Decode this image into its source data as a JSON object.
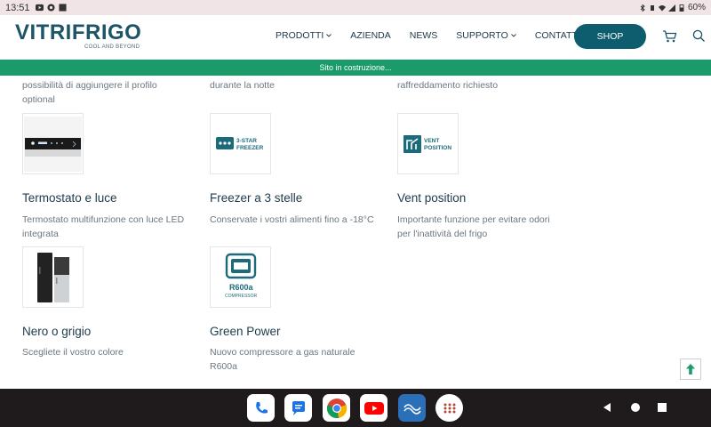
{
  "status": {
    "time": "13:51",
    "battery": "60%"
  },
  "header": {
    "logo": {
      "name": "VITRIFRIGO",
      "tagline": "COOL AND BEYOND"
    },
    "nav": [
      {
        "label": "PRODOTTI",
        "dropdown": true
      },
      {
        "label": "AZIENDA",
        "dropdown": false
      },
      {
        "label": "NEWS",
        "dropdown": false
      },
      {
        "label": "SUPPORTO",
        "dropdown": true
      },
      {
        "label": "CONTATTI",
        "dropdown": true
      }
    ],
    "shop_label": "SHOP",
    "accent": "#0e5d6e"
  },
  "banner": {
    "text": "Sito in costruzione...",
    "color": "#1c9b6a"
  },
  "fragments": {
    "col1_line1": "possibilità di aggiungere il profilo",
    "col1_line2": "optional",
    "col2_line1": "durante la notte",
    "col3_line1": "raffreddamento richiesto"
  },
  "features": [
    {
      "title": "Termostato e luce",
      "desc_lines": [
        "Termostato multifunzione con luce LED",
        "integrata"
      ],
      "icon": "thermostat-light-image"
    },
    {
      "title": "Freezer a 3 stelle",
      "desc_lines": [
        "Conservate i vostri alimenti fino a -18°C"
      ],
      "icon": "three-star-freezer-icon",
      "icon_text": [
        "3-STAR",
        "FREEZER"
      ]
    },
    {
      "title": "Vent position",
      "desc_lines": [
        "Importante funzione per evitare odori",
        "per l'inattività del frigo"
      ],
      "icon": "vent-position-icon",
      "icon_text": [
        "VENT",
        "POSITION"
      ]
    },
    {
      "title": "Nero o grigio",
      "desc_lines": [
        "Scegliete il vostro colore"
      ],
      "icon": "fridge-colors-image"
    },
    {
      "title": "Green Power",
      "desc_lines": [
        "Nuovo compressore a gas naturale",
        "R600a"
      ],
      "icon": "r600a-compressor-icon",
      "icon_text": [
        "R600a",
        "COMPRESSOR"
      ]
    }
  ],
  "dock": [
    "phone-app-icon",
    "messages-app-icon",
    "chrome-app-icon",
    "youtube-app-icon",
    "victron-app-icon",
    "app-drawer-icon"
  ]
}
